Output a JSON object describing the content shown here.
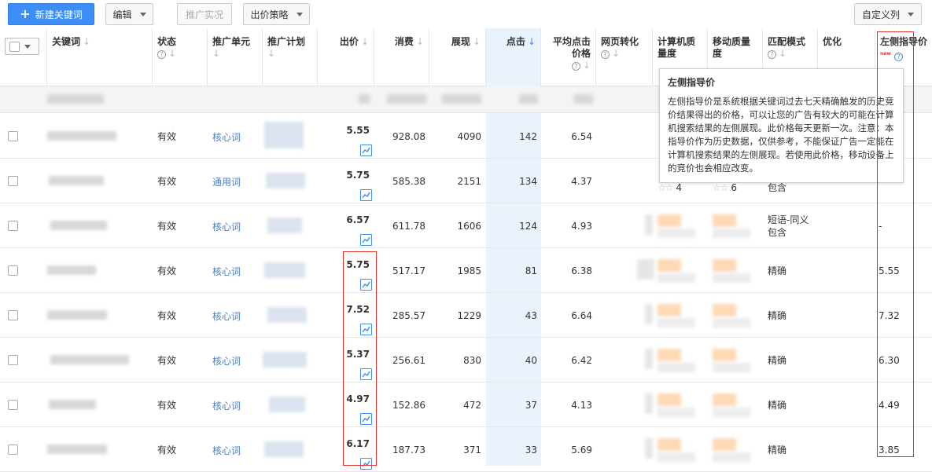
{
  "toolbar": {
    "new_keyword": "新建关键词",
    "edit": "编辑",
    "preview": "推广实况",
    "bid_strategy": "出价策略",
    "custom_columns": "自定义列"
  },
  "columns": {
    "keyword": "关键词",
    "status": "状态",
    "unit": "推广单元",
    "plan": "推广计划",
    "bid": "出价",
    "cost": "消费",
    "impressions": "展现",
    "clicks": "点击",
    "avg_cpc": "平均点击价格",
    "conversion": "网页转化",
    "pc_quality": "计算机质量度",
    "mobile_quality": "移动质量度",
    "match_type": "匹配模式",
    "optimize": "优化",
    "left_guide": "左侧指导价",
    "new_badge": "new"
  },
  "tooltip": {
    "title": "左侧指导价",
    "body": "左侧指导价是系统根据关键词过去七天精确触发的历史竞价结果得出的价格，可以让您的广告有较大的可能在计算机搜索结果的左侧展现。此价格每天更新一次。注意：本指导价作为历史数据，仅供参考，不能保证广告一定能在计算机搜索结果的左侧展现。若使用此价格，移动设备上的竞价也会相应改变。"
  },
  "rows": [
    {
      "status": "有效",
      "unit": "核心词",
      "bid": "5.55",
      "cost": "928.08",
      "impr": "4090",
      "clicks": "142",
      "cpc": "6.54",
      "match": "",
      "guide": ""
    },
    {
      "status": "有效",
      "unit": "通用词",
      "bid": "5.75",
      "cost": "585.38",
      "impr": "2151",
      "clicks": "134",
      "cpc": "4.37",
      "match": "包含",
      "guide": "",
      "stars_pc": "4",
      "stars_m": "6"
    },
    {
      "status": "有效",
      "unit": "核心词",
      "bid": "6.57",
      "cost": "611.78",
      "impr": "1606",
      "clicks": "124",
      "cpc": "4.93",
      "match": "短语-同义包含",
      "guide": "-"
    },
    {
      "status": "有效",
      "unit": "核心词",
      "bid": "5.75",
      "cost": "517.17",
      "impr": "1985",
      "clicks": "81",
      "cpc": "6.38",
      "match": "精确",
      "guide": "5.55"
    },
    {
      "status": "有效",
      "unit": "核心词",
      "bid": "7.52",
      "cost": "285.57",
      "impr": "1229",
      "clicks": "43",
      "cpc": "6.64",
      "match": "精确",
      "guide": "7.32"
    },
    {
      "status": "有效",
      "unit": "核心词",
      "bid": "5.37",
      "cost": "256.61",
      "impr": "830",
      "clicks": "40",
      "cpc": "6.42",
      "match": "精确",
      "guide": "6.30"
    },
    {
      "status": "有效",
      "unit": "核心词",
      "bid": "4.97",
      "cost": "152.86",
      "impr": "472",
      "clicks": "37",
      "cpc": "4.13",
      "match": "精确",
      "guide": "4.49"
    },
    {
      "status": "有效",
      "unit": "核心词",
      "bid": "6.17",
      "cost": "187.73",
      "impr": "371",
      "clicks": "33",
      "cpc": "5.69",
      "match": "精确",
      "guide": "3.85"
    }
  ]
}
